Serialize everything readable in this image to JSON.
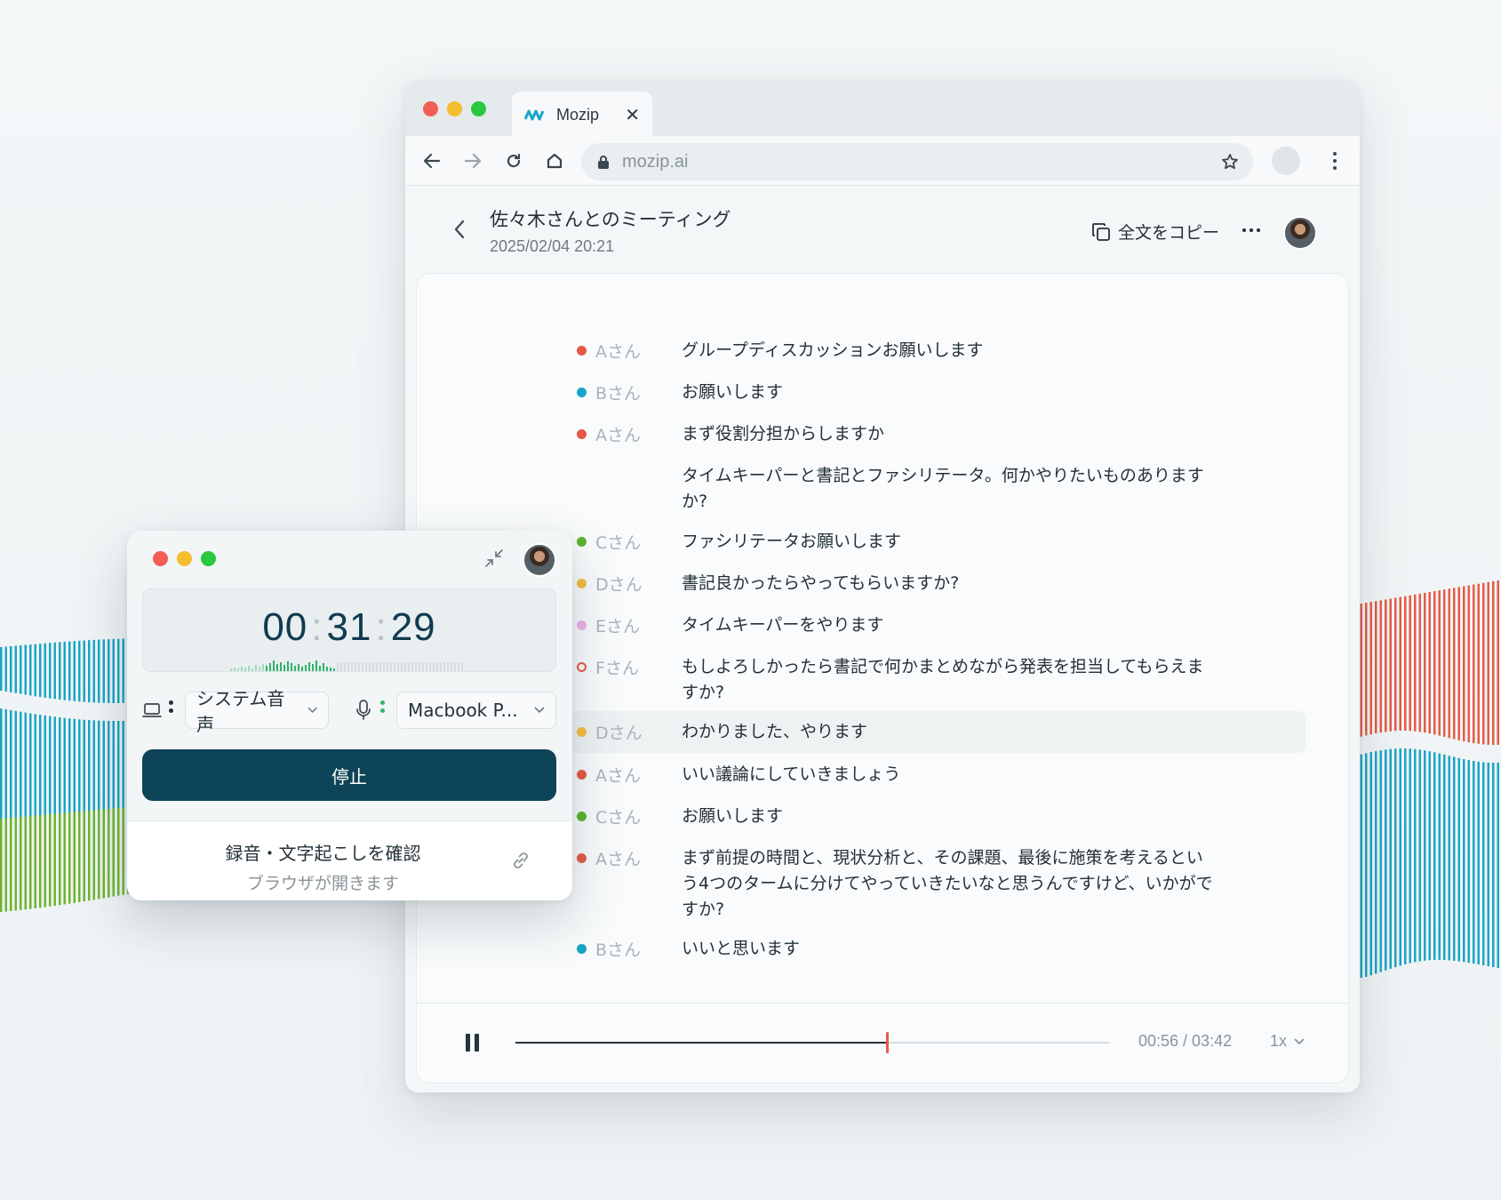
{
  "browser": {
    "tab_title": "Mozip",
    "url": "mozip.ai"
  },
  "page": {
    "title": "佐々木さんとのミーティング",
    "date": "2025/02/04 20:21",
    "copy_label": "全文をコピー"
  },
  "colors": {
    "accent_dark": "#0e4458",
    "speaker_a": "#e65a47",
    "speaker_b": "#19a5c6",
    "speaker_c": "#5bb32e",
    "speaker_d": "#f3bd3f",
    "speaker_e": "#f0b1e8",
    "speaker_f": "#e65a47"
  },
  "transcript": [
    {
      "speaker": "Aさん",
      "text": "グループディスカッションお願いします"
    },
    {
      "speaker": "Bさん",
      "text": "お願いします"
    },
    {
      "speaker": "Aさん",
      "text": "まず役割分担からしますか"
    },
    {
      "speaker": "",
      "text": "タイムキーパーと書記とファシリテータ。何かやりたいものありますか?"
    },
    {
      "speaker": "Cさん",
      "text": "ファシリテータお願いします"
    },
    {
      "speaker": "Dさん",
      "text": "書記良かったらやってもらいますか?"
    },
    {
      "speaker": "Eさん",
      "text": "タイムキーパーをやります"
    },
    {
      "speaker": "Fさん",
      "text": "もしよろしかったら書記で何かまとめながら発表を担当してもらえますか?"
    },
    {
      "speaker": "Dさん",
      "text": "わかりました、やります"
    },
    {
      "speaker": "Aさん",
      "text": "いい議論にしていきましょう"
    },
    {
      "speaker": "Cさん",
      "text": "お願いします"
    },
    {
      "speaker": "Aさん",
      "text": "まず前提の時間と、現状分析と、その課題、最後に施策を考えるという4つのタームに分けてやっていきたいなと思うんですけど、いかがですか?"
    },
    {
      "speaker": "Bさん",
      "text": "いいと思います"
    }
  ],
  "player": {
    "time": "00:56 / 03:42",
    "progress": 0.625,
    "speed": "1x"
  },
  "recorder": {
    "hours": "00",
    "minutes": "31",
    "seconds": "29",
    "system_audio": "システム音声",
    "mic": "Macbook P...",
    "stop_label": "停止",
    "footer_title": "録音・文字起こしを確認",
    "footer_sub": "ブラウザが開きます"
  }
}
